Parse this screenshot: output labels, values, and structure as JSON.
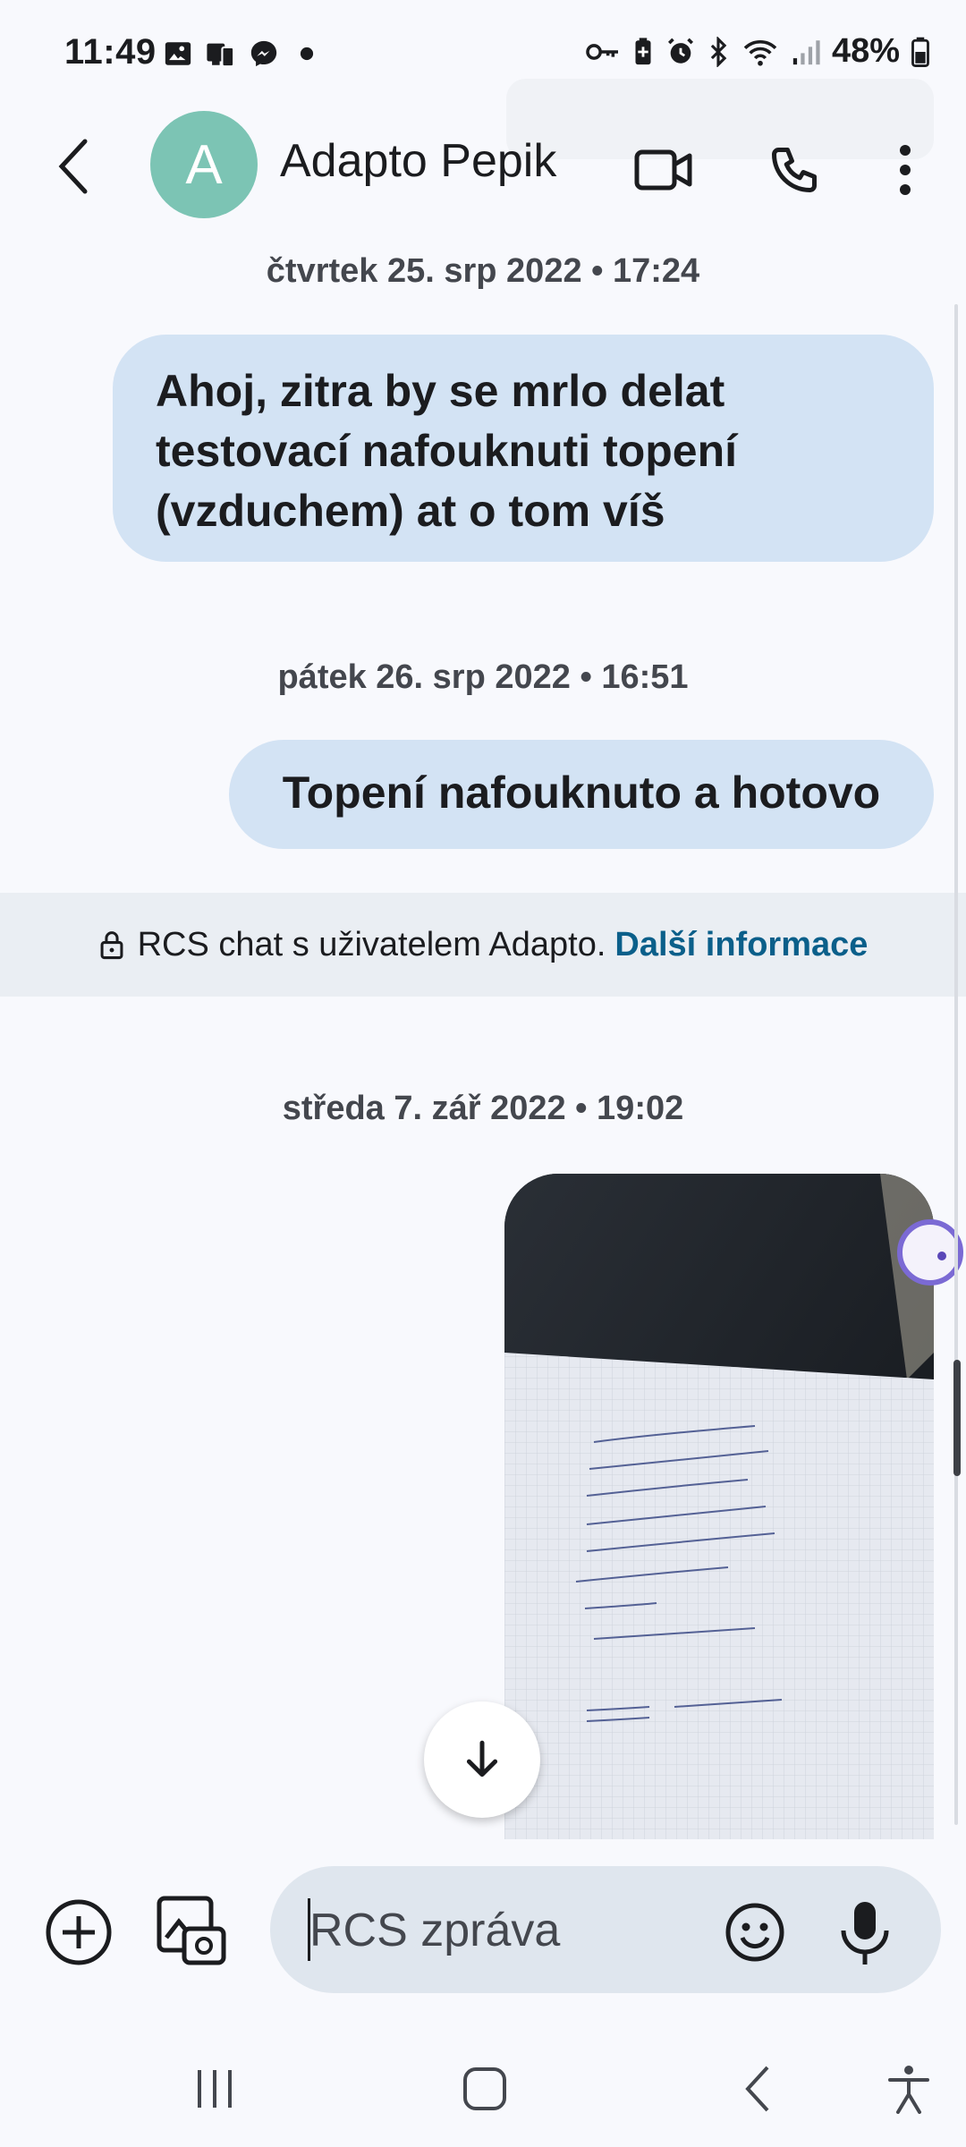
{
  "status_bar": {
    "time": "11:49",
    "battery": "48%",
    "left_icons": [
      "gallery-icon",
      "phone-link-icon",
      "messenger-icon",
      "dot-icon"
    ],
    "right_icons": [
      "key-icon",
      "battery-saver-icon",
      "alarm-icon",
      "bluetooth-icon",
      "wifi-icon",
      "signal-icon",
      "battery-icon"
    ]
  },
  "header": {
    "avatar_letter": "A",
    "contact_name": "Adapto Pepik"
  },
  "messages": [
    {
      "date": "čtvrtek 25. srp 2022 • 17:24",
      "text": "Ahoj, zitra by se mrlo delat testovací nafouknuti topení (vzduchem) at o tom víš"
    },
    {
      "date": "pátek 26. srp 2022 • 16:51",
      "text": "Topení nafouknuto a hotovo"
    }
  ],
  "rcs_banner": {
    "text": "RCS chat s uživatelem Adapto.",
    "link": "Další informace"
  },
  "image_message": {
    "date": "středa 7. zář 2022 • 19:02"
  },
  "compose": {
    "placeholder": "RCS zpráva"
  },
  "colors": {
    "bubble": "#d3e3f4",
    "avatar": "#7cc4b4",
    "link": "#0b5f8a",
    "background": "#f8f9fd"
  }
}
